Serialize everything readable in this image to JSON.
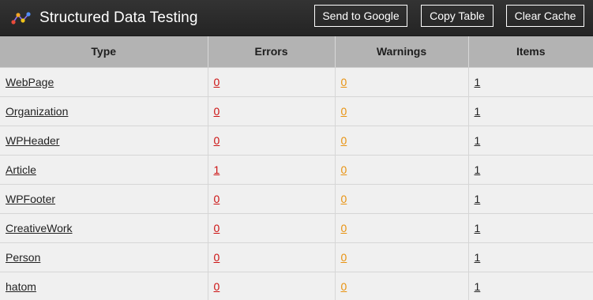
{
  "header": {
    "title": "Structured Data Testing",
    "send_label": "Send to Google",
    "copy_label": "Copy Table",
    "clear_label": "Clear Cache"
  },
  "colors": {
    "header_bg": "#2b2b2b",
    "error": "#cc1111",
    "warning": "#e8920f",
    "table_header_bg": "#b3b3b3",
    "row_bg": "#f0f0f0"
  },
  "table": {
    "columns": [
      "Type",
      "Errors",
      "Warnings",
      "Items"
    ],
    "rows": [
      {
        "type": "WebPage",
        "errors": "0",
        "warnings": "0",
        "items": "1"
      },
      {
        "type": "Organization",
        "errors": "0",
        "warnings": "0",
        "items": "1"
      },
      {
        "type": "WPHeader",
        "errors": "0",
        "warnings": "0",
        "items": "1"
      },
      {
        "type": "Article",
        "errors": "1",
        "warnings": "0",
        "items": "1"
      },
      {
        "type": "WPFooter",
        "errors": "0",
        "warnings": "0",
        "items": "1"
      },
      {
        "type": "CreativeWork",
        "errors": "0",
        "warnings": "0",
        "items": "1"
      },
      {
        "type": "Person",
        "errors": "0",
        "warnings": "0",
        "items": "1"
      },
      {
        "type": "hatom",
        "errors": "0",
        "warnings": "0",
        "items": "1"
      }
    ]
  }
}
